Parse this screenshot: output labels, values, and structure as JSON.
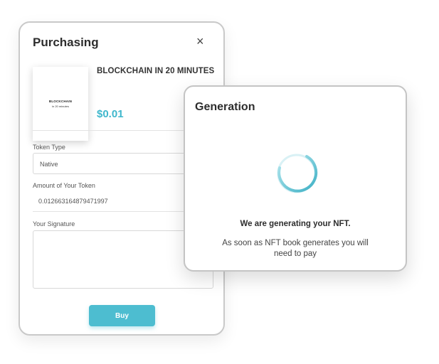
{
  "purchase": {
    "title": "Purchasing",
    "close_icon": "×",
    "book_cover": {
      "line1": "BLOCKCHAIN",
      "line2": "in 20 minutes"
    },
    "product_name": "BLOCKCHAIN IN 20 MINUTES",
    "price": "$0.01",
    "token_type": {
      "label": "Token Type",
      "value": "Native"
    },
    "amount": {
      "label": "Amount of Your Token",
      "value": "0.012663164879471997"
    },
    "signature": {
      "label": "Your Signature",
      "value": ""
    },
    "buy_label": "Buy"
  },
  "generation": {
    "title": "Generation",
    "heading": "We are generating your NFT.",
    "subtext": "As soon as NFT book generates you will need to pay",
    "spinner_icon": "loading-spinner-icon"
  },
  "colors": {
    "accent": "#4dbdd0",
    "price": "#3fb7cc"
  }
}
